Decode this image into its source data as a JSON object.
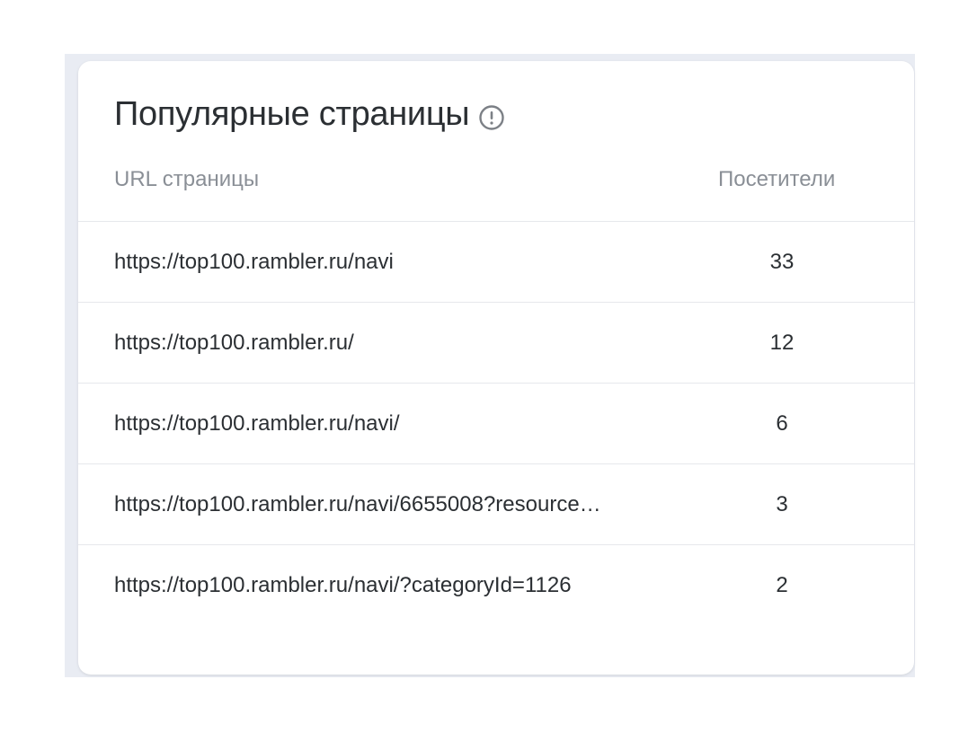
{
  "widget": {
    "title": "Популярные страницы",
    "info_icon": "info-circle-icon",
    "columns": {
      "url": "URL страницы",
      "visitors": "Посетители"
    },
    "rows": [
      {
        "url": "https://top100.rambler.ru/navi",
        "visitors": "33"
      },
      {
        "url": "https://top100.rambler.ru/",
        "visitors": "12"
      },
      {
        "url": "https://top100.rambler.ru/navi/",
        "visitors": "6"
      },
      {
        "url": "https://top100.rambler.ru/navi/6655008?resource…",
        "visitors": "3"
      },
      {
        "url": "https://top100.rambler.ru/navi/?categoryId=1126",
        "visitors": "2"
      }
    ]
  },
  "colors": {
    "text": "#2b2f33",
    "muted": "#8a8f96",
    "divider": "#e6e8ec",
    "background": "#e9ecf3"
  }
}
